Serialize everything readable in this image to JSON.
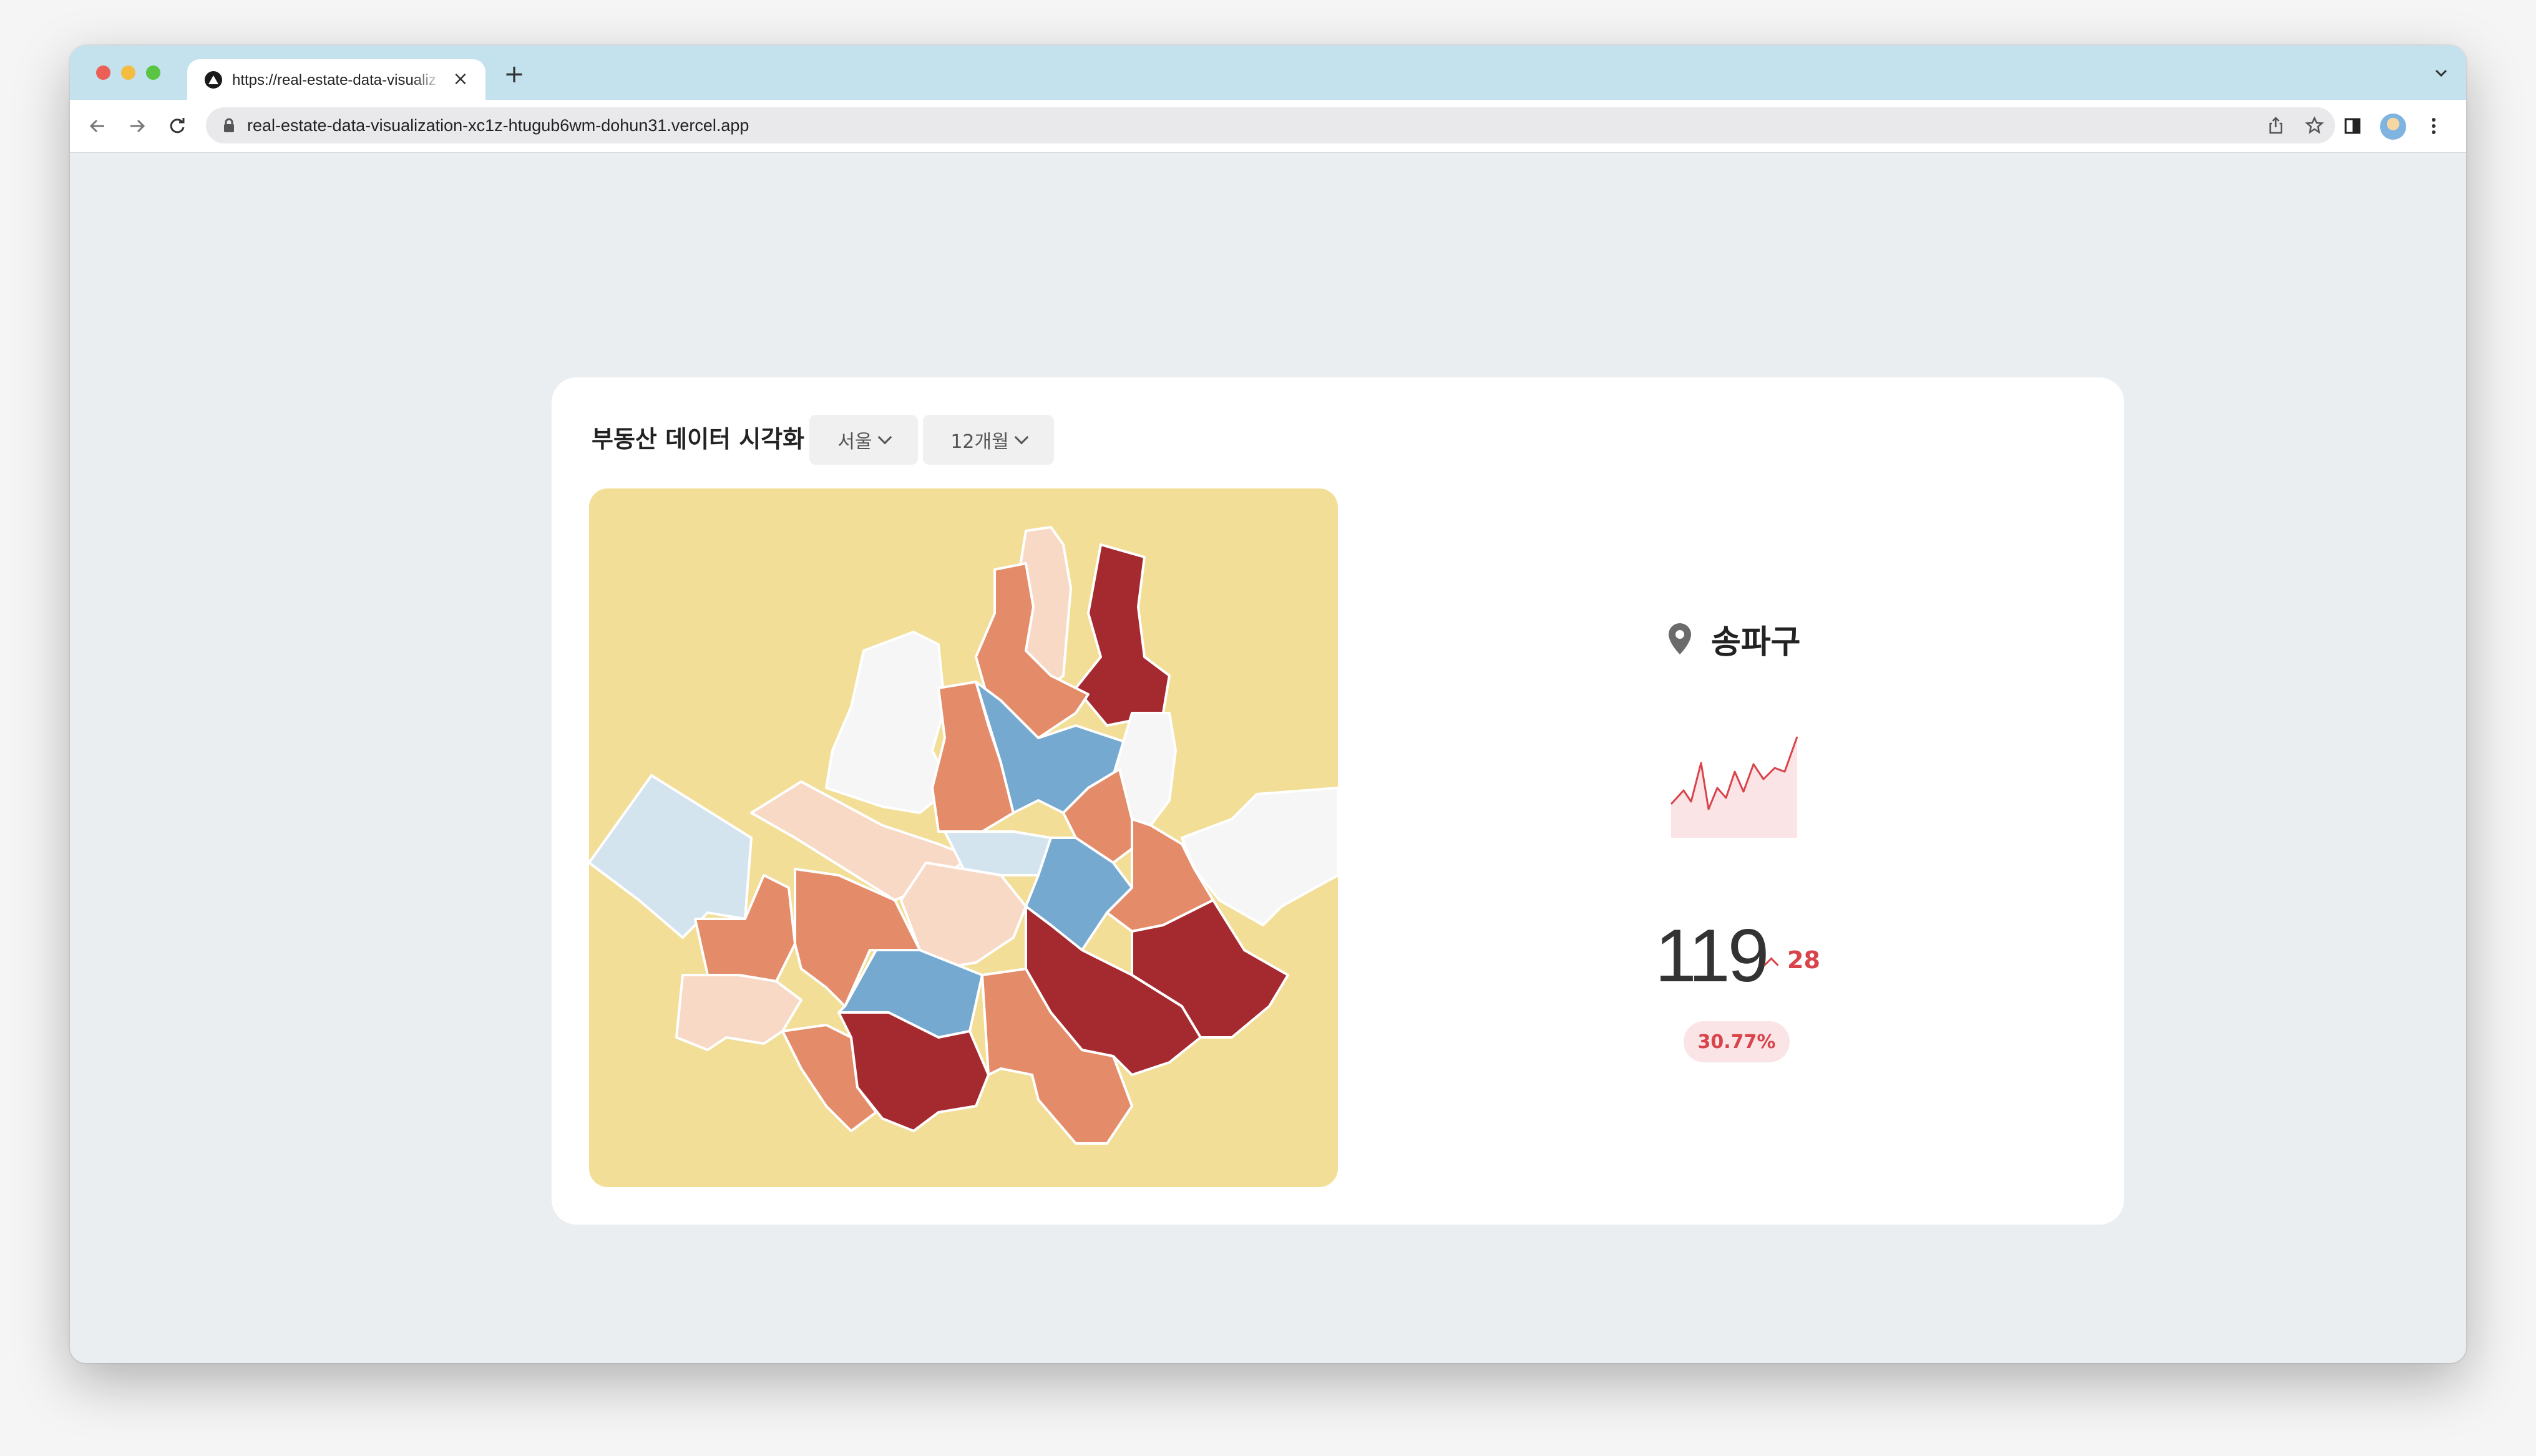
{
  "browser": {
    "tab_title": "https://real-estate-data-visualization-xc1z-htugub6wm-dohun31.vercel.app",
    "url": "real-estate-data-visualization-xc1z-htugub6wm-dohun31.vercel.app",
    "tab_close": "×",
    "new_tab": "+"
  },
  "page": {
    "title": "부동산 데이터 시각화",
    "city_select": "서울",
    "period_select": "12개월"
  },
  "detail": {
    "district": "송파구",
    "value": "119",
    "delta": "28",
    "percent": "30.77%",
    "trend_color": "#d9434a",
    "trend_fill": "#fbe4e5"
  },
  "map_colors": {
    "background": "#f2de97",
    "dark_red": "#a52a30",
    "orange": "#e48c69",
    "light_peach": "#f8d9c6",
    "white": "#f6f6f6",
    "light_blue": "#d4e4ef",
    "blue": "#75a9cf"
  }
}
